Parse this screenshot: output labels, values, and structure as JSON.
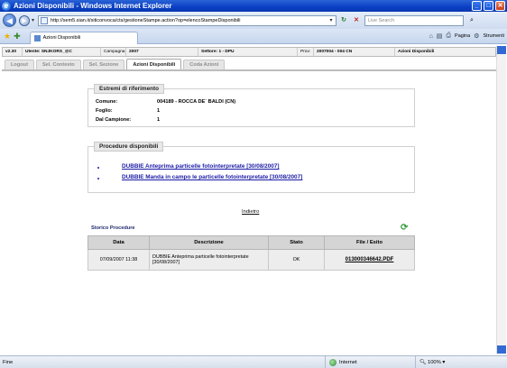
{
  "window": {
    "title": "Azioni Disponibili - Windows Internet Explorer"
  },
  "addressbar": {
    "url": "http://sem5.sian.it/siticonvoca/cts/gestioneStampe.action?op=elencoStampeDisponibili",
    "search_placeholder": "Live Search"
  },
  "toolbar": {
    "tab_label": "Azioni Disponibili",
    "page_label": "Pagina",
    "tools_label": "Strumenti"
  },
  "info": {
    "version": "v2.30",
    "user": "Utente: SNJKORS_@C",
    "campaign_label": "Campagna:",
    "campaign_value": "2007",
    "sector": "Settore: 1 - DPU",
    "prov_label": "Prov:",
    "prov_value": "2007004 - 004 CN",
    "page": "Azioni Disponibili"
  },
  "apptabs": [
    "Logout",
    "Sel. Contesto",
    "Sel. Sezione",
    "Azioni Disponibili",
    "Coda Azioni"
  ],
  "estremi": {
    "legend": "Estremi di riferimento",
    "comune_label": "Comune:",
    "comune_value": "004189 - ROCCA DE` BALDI (CN)",
    "foglio_label": "Foglio:",
    "foglio_value": "1",
    "campione_label": "Dal Campione:",
    "campione_value": "1"
  },
  "procedure": {
    "legend": "Procedure disponibili",
    "links": [
      "DUBBIE Anteprima particelle fotointerpretate [30/08/2007]",
      "DUBBIE Manda in campo le particelle fotointerpretate [30/08/2007]"
    ]
  },
  "back_link": "Indietro",
  "storico": {
    "title": "Storico Procedure",
    "headers": [
      "Data",
      "Descrizione",
      "Stato",
      "File / Esito"
    ],
    "rows": [
      {
        "data": "07/09/2007 11:38",
        "descrizione": "DUBBIE Anteprima particelle fotointerpretate [30/08/2007]",
        "stato": "OK",
        "file": "013000346642.PDF"
      }
    ]
  },
  "statusbar": {
    "left": "Fine",
    "zone": "Internet",
    "zoom": "100%"
  }
}
